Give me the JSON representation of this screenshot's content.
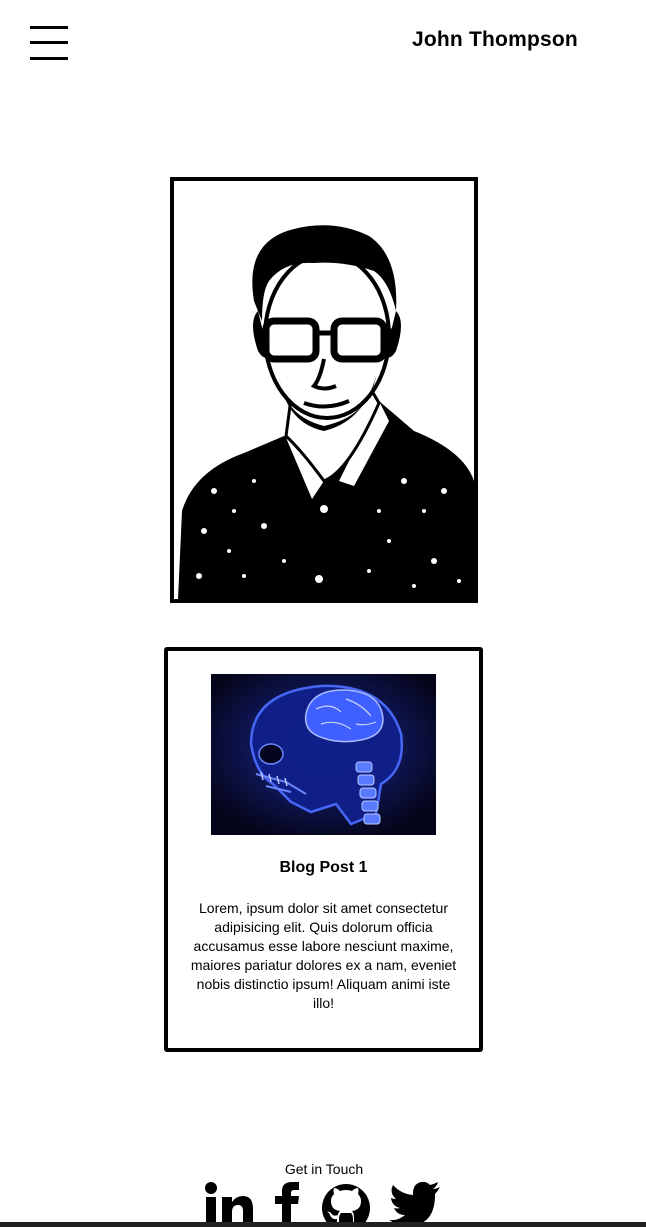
{
  "header": {
    "menu_icon": "hamburger-menu-icon",
    "site_title": "John Thompson"
  },
  "portrait": {
    "image": "portrait-sketch-man-with-glasses"
  },
  "blog_card": {
    "image": "xray-skull-brain-image",
    "title": "Blog Post 1",
    "body": "Lorem, ipsum dolor sit amet consectetur adipisicing elit. Quis dolorum officia accusamus esse labore nesciunt maxime, maiores pariatur dolores ex a nam, eveniet nobis distinctio ipsum! Aliquam animi iste illo!"
  },
  "footer": {
    "label": "Get in Touch",
    "social_icons": [
      "linkedin-icon",
      "facebook-icon",
      "github-icon",
      "twitter-icon"
    ]
  },
  "colors": {
    "background": "#ffffff",
    "text": "#000000",
    "xray_blue": "#2a4cff"
  }
}
